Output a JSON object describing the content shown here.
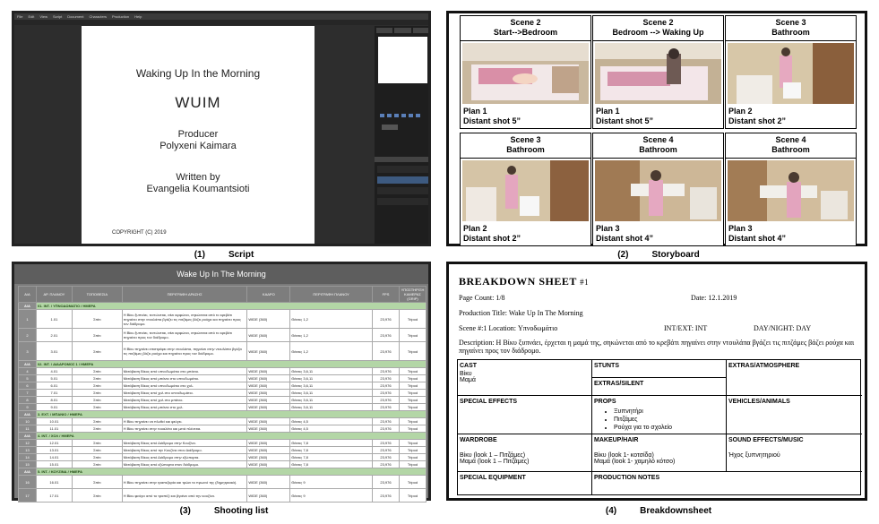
{
  "captions": [
    {
      "num": "(1)",
      "label": "Script"
    },
    {
      "num": "(2)",
      "label": "Storyboard"
    },
    {
      "num": "(3)",
      "label": "Shooting list"
    },
    {
      "num": "(4)",
      "label": "Breakdownsheet"
    }
  ],
  "script": {
    "menu": [
      "File",
      "Edit",
      "View",
      "Script",
      "Document",
      "Characters",
      "Production",
      "Help"
    ],
    "title": "Waking Up In the Morning",
    "abbr": "WUIM",
    "producer_label": "Producer",
    "producer_name": "Polyxeni Kaimara",
    "written_label": "Written by",
    "written_name": "Evangelia Koumantsioti",
    "copyright": "COPYRIGHT (C) 2019"
  },
  "storyboard": {
    "cells": [
      {
        "scene": "Scene 2",
        "location": "Start-->Bedroom",
        "plan": "Plan 1",
        "shot": "Distant shot 5”"
      },
      {
        "scene": "Scene 2",
        "location": "Bedroom --> Waking Up",
        "plan": "Plan 1",
        "shot": "Distant shot 5”"
      },
      {
        "scene": "Scene 3",
        "location": "Bathroom",
        "plan": "Plan 2",
        "shot": "Distant shot 2”"
      },
      {
        "scene": "Scene 3",
        "location": "Bathroom",
        "plan": "Plan 2",
        "shot": "Distant shot 2”"
      },
      {
        "scene": "Scene 4",
        "location": "Bathroom",
        "plan": "Plan 3",
        "shot": "Distant shot 4”"
      },
      {
        "scene": "Scene 4",
        "location": "Bathroom",
        "plan": "Plan 3",
        "shot": "Distant shot 4”"
      }
    ]
  },
  "shooting_list": {
    "title": "Wake Up In The Morning",
    "headers": [
      "A/A",
      "AP. ΠΛΑΝΟΥ",
      "ΤΟΠΟΘΕΣΙΑ",
      "ΠΕΡΙΓΡΑΦΗ ΔΡΑΣΗΣ",
      "ΚΑΔΡΟ",
      "ΠΕΡΙΓΡΑΦΗ ΠΛΑΝΟΥ",
      "FPS",
      "ΥΠΟΣΤΗΡΙΞΗ ΚΑΜΕΡΑΣ (GRIP)"
    ],
    "rows": [
      {
        "type": "sec",
        "aa": "A/A",
        "text": "01. INT. / ΥΠΝΟΔΩΜΑΤΙΟ / ΗΜΕΡΑ"
      },
      {
        "type": "tall3",
        "aa": "1",
        "num": "1.01",
        "loc": "Σπίτι",
        "desc": "Η Βίκυ ξυπνάει, τεντώνεται, σέει κιρφώνει, σηκώνεται από το κρεβάτι πηγαίνει στην ντουλάπα βγάζει τις πιτζάμες βάζει ρούχα και πηγαίνει προς τον διάδρομο.",
        "frame": "WIDE (360)",
        "plan": "Θέσεις 1,2",
        "fps": "23,976",
        "grip": "Tripod"
      },
      {
        "type": "tall",
        "aa": "2",
        "num": "2.01",
        "loc": "Σπίτι",
        "desc": "Η Βίκυ ξυπνάει, τεντώνεται, σέει κιρφώνει, σηκώνεται από το κρεβάτι πηγαίνει προς τον διάδρομο.",
        "frame": "WIDE (360)",
        "plan": "Θέσεις 1,2",
        "fps": "23,976",
        "grip": "Tripod"
      },
      {
        "type": "tall3",
        "aa": "3",
        "num": "3.01",
        "loc": "Σπίτι",
        "desc": "Η Βίκυ πηγαίνει επιστρέφει στην ντουλάπα, πηγαίνει στην ντουλάπα βγάζει τις πιτζάμες βάζει ρούχα και πηγαίνει προς τον διάδρομο.",
        "frame": "WIDE (360)",
        "plan": "Θέσεις 1,2",
        "fps": "23,976",
        "grip": "Tripod"
      },
      {
        "type": "sec",
        "aa": "A/A",
        "text": "02. INT. / ΔΙΑΔΡΟΜΟΣ 1 / ΗΜΕΡΑ"
      },
      {
        "type": "row",
        "aa": "4",
        "num": "4.01",
        "loc": "Σπίτι",
        "desc": "Μετάβαση Βίκυς από υπνοδωμάτιο στο μπάνιο.",
        "frame": "WIDE (360)",
        "plan": "Θέσεις 3,6,11",
        "fps": "23,976",
        "grip": "Tripod"
      },
      {
        "type": "row",
        "aa": "5",
        "num": "5.01",
        "loc": "Σπίτι",
        "desc": "Μετάβαση Βίκυς από μπάνιο στο υπνοδωμάτιο.",
        "frame": "WIDE (360)",
        "plan": "Θέσεις 3,6,11",
        "fps": "23,976",
        "grip": "Tripod"
      },
      {
        "type": "row",
        "aa": "6",
        "num": "6.01",
        "loc": "Σπίτι",
        "desc": "Μετάβαση Βίκυς από υπνοδωμάτιο στο χολ.",
        "frame": "WIDE (360)",
        "plan": "Θέσεις 3,6,11",
        "fps": "23,976",
        "grip": "Tripod"
      },
      {
        "type": "row",
        "aa": "7",
        "num": "7.01",
        "loc": "Σπίτι",
        "desc": "Μετάβαση Βίκυς από χολ στο υπνοδωμάτιο.",
        "frame": "WIDE (360)",
        "plan": "Θέσεις 3,6,11",
        "fps": "23,976",
        "grip": "Tripod"
      },
      {
        "type": "row",
        "aa": "8",
        "num": "8.01",
        "loc": "Σπίτι",
        "desc": "Μετάβαση Βίκυς από χολ στο μπάνιο.",
        "frame": "WIDE (360)",
        "plan": "Θέσεις 3,6,11",
        "fps": "23,976",
        "grip": "Tripod"
      },
      {
        "type": "row",
        "aa": "9",
        "num": "9.01",
        "loc": "Σπίτι",
        "desc": "Μετάβαση Βίκυς από μπάνιο στο χολ.",
        "frame": "WIDE (360)",
        "plan": "Θέσεις 3,6,11",
        "fps": "23,976",
        "grip": "Tripod"
      },
      {
        "type": "sec",
        "aa": "A/A",
        "text": "3. EXT. / ΜΠΑΝΙΟ / ΗΜΕΡΑ"
      },
      {
        "type": "row",
        "aa": "10",
        "num": "10.01",
        "loc": "Σπίτι",
        "desc": "Η Βίκυ πηγαίνει να πλυθεί και φεύγει.",
        "frame": "WIDE (360)",
        "plan": "Θέσεις 4,5",
        "fps": "23,976",
        "grip": "Tripod"
      },
      {
        "type": "row",
        "aa": "11",
        "num": "11.01",
        "loc": "Σπίτι",
        "desc": "Η Βίκυ πηγαίνει στην τουαλέτα και μετά πλένεται.",
        "frame": "WIDE (360)",
        "plan": "Θέσεις 4,5",
        "fps": "23,976",
        "grip": "Tripod"
      },
      {
        "type": "sec",
        "aa": "A/A",
        "text": "4. INT. / ΧΟΛ / ΗΜΕΡΑ"
      },
      {
        "type": "row",
        "aa": "12",
        "num": "12.01",
        "loc": "Σπίτι",
        "desc": "Μετάβαση Βίκυς από Διάδρομο στην Κουζίνα.",
        "frame": "WIDE (360)",
        "plan": "Θέσεις 7,8",
        "fps": "23,976",
        "grip": "Tripod"
      },
      {
        "type": "row",
        "aa": "13",
        "num": "13.01",
        "loc": "Σπίτι",
        "desc": "Μετάβαση Βίκυς από την Κουζίνα στον Διάδρομο.",
        "frame": "WIDE (360)",
        "plan": "Θέσεις 7,8",
        "fps": "23,976",
        "grip": "Tripod"
      },
      {
        "type": "row",
        "aa": "14",
        "num": "14.01",
        "loc": "Σπίτι",
        "desc": "Μετάβαση Βίκυς από Διάδρομο στην εξώπορτα.",
        "frame": "WIDE (360)",
        "plan": "Θέσεις 7,8",
        "fps": "23,976",
        "grip": "Tripod"
      },
      {
        "type": "row",
        "aa": "15",
        "num": "15.01",
        "loc": "Σπίτι",
        "desc": "Μετάβαση Βίκυς από εξώπορτα στον διάδρομο.",
        "frame": "WIDE (360)",
        "plan": "Θέσεις 7,8",
        "fps": "23,976",
        "grip": "Tripod"
      },
      {
        "type": "sec",
        "aa": "A/A",
        "text": "5. INT. / ΚΟΥΖΙΝΑ / ΗΜΕΡΑ"
      },
      {
        "type": "tall",
        "aa": "16",
        "num": "16.01",
        "loc": "Σπίτι",
        "desc": "Η Βίκυ πηγαίνει στην τραπεζαρία και τρώει το πρωινό της (δημητριακά).",
        "frame": "WIDE (360)",
        "plan": "Θέσεις 9",
        "fps": "23,976",
        "grip": "Tripod"
      },
      {
        "type": "tall",
        "aa": "17",
        "num": "17.01",
        "loc": "Σπίτι",
        "desc": "Η Βίκυ φεύγει από το τραπέζι και βγαίνει από την κουζίνα.",
        "frame": "WIDE (360)",
        "plan": "Θέσεις 9",
        "fps": "23,976",
        "grip": "Tripod"
      }
    ]
  },
  "breakdown": {
    "heading": "BREAKDOWN SHEET",
    "sheet_no": "#1",
    "page_count": "Page Count: 1/8",
    "date": "Date: 12.1.2019",
    "production_title": "Production Title: Wake Up In The Morning",
    "scene": "Scene #:1  Location: Υπνοδωμάτιο",
    "int_ext": "INT/EXT: INT",
    "day_night": "DAY/NIGHT: DAY",
    "description": "Description: Η Βίκυ ξυπνάει, έρχεται η μαμά της, σηκώνεται από το κρεβάτι πηγαίνει στην ντουλάπα βγάζει τις πιτζάμες βάζει ρούχα και πηγαίνει προς τον διάδρομο.",
    "cast_label": "CAST",
    "cast": [
      "Βίκυ",
      "Μαμά"
    ],
    "stunts_label": "STUNTS",
    "extras_atm_label": "EXTRAS/ATMOSPHERE",
    "extras_silent_label": "EXTRAS/SILENT",
    "sfx_label": "SPECIAL EFFECTS",
    "props_label": "PROPS",
    "props": [
      "Ξυπνητήρι",
      "Πιτζάμες",
      "Ρούχα για το σχολείο"
    ],
    "vehicles_label": "VEHICLES/ANIMALS",
    "wardrobe_label": "WARDROBE",
    "wardrobe": [
      "Βίκυ (look 1 – Πιτζάμες)",
      "Μαμά (look 1 – Πιτζάμες)"
    ],
    "makeup_label": "MAKEUP/HAIR",
    "makeup": [
      "Βίκυ (look 1- κοτσίδα)",
      "Μαμά (look 1- χαμηλό κότσο)"
    ],
    "sound_label": "SOUND EFFECTS/MUSIC",
    "sound": "Ήχος ξυπνητηριού",
    "equipment_label": "SPECIAL EQUIPMENT",
    "notes_label": "PRODUCTION NOTES"
  }
}
